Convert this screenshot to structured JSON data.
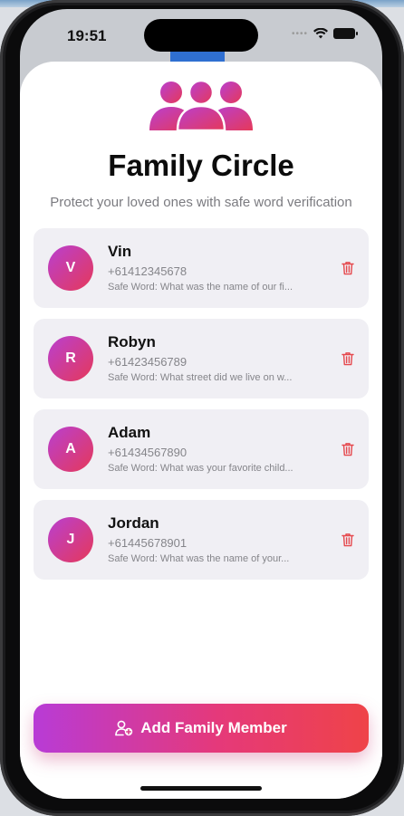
{
  "status_bar": {
    "time": "19:51",
    "signal_dots": "••••"
  },
  "header": {
    "title": "Family Circle",
    "subtitle": "Protect your loved ones with safe word verification"
  },
  "members": [
    {
      "initial": "V",
      "name": "Vin",
      "phone": "+61412345678",
      "safe_word": "Safe Word: What was the name of our fi..."
    },
    {
      "initial": "R",
      "name": "Robyn",
      "phone": "+61423456789",
      "safe_word": "Safe Word: What street did we live on w..."
    },
    {
      "initial": "A",
      "name": "Adam",
      "phone": "+61434567890",
      "safe_word": "Safe Word: What was your favorite child..."
    },
    {
      "initial": "J",
      "name": "Jordan",
      "phone": "+61445678901",
      "safe_word": "Safe Word: What was the name of your..."
    }
  ],
  "actions": {
    "add_label": "Add Family Member"
  },
  "colors": {
    "gradient_start": "#b83bd6",
    "gradient_end": "#ef4348",
    "delete_red": "#e5484d",
    "card_bg": "#f0eff4"
  },
  "icons": {
    "hero": "family-group-icon",
    "delete": "trash-icon",
    "add": "add-person-icon"
  }
}
